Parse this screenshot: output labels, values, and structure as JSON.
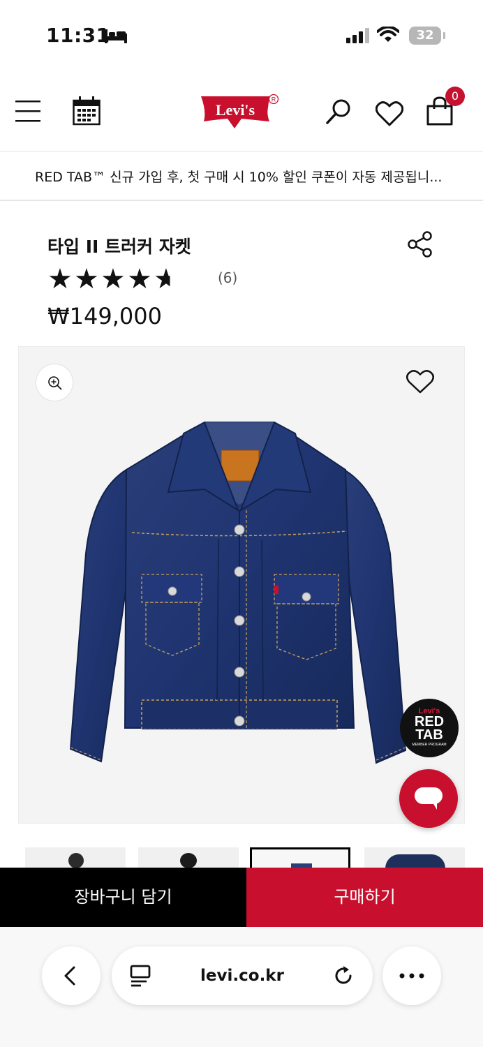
{
  "status_bar": {
    "time": "11:31",
    "battery": "32"
  },
  "header": {
    "brand": "Levi's",
    "cart_count": "0"
  },
  "promo": {
    "text": "RED TAB™ 신규 가입 후, 첫 구매 시 10% 할인 쿠폰이 자동 제공됩니..."
  },
  "product": {
    "title": "타입 II 트러커 자켓",
    "rating": 4.5,
    "stars": "★★★★★",
    "review_count": "(6)",
    "price": "₩149,000"
  },
  "badge": {
    "brand": "Levi's",
    "line1": "RED",
    "line2": "TAB",
    "line3": "MEMBER PROGRAM"
  },
  "actions": {
    "add_to_cart": "장바구니 담기",
    "buy_now": "구매하기"
  },
  "browser": {
    "url": "levi.co.kr"
  },
  "colors": {
    "brand_red": "#c8102e",
    "black": "#000000"
  }
}
